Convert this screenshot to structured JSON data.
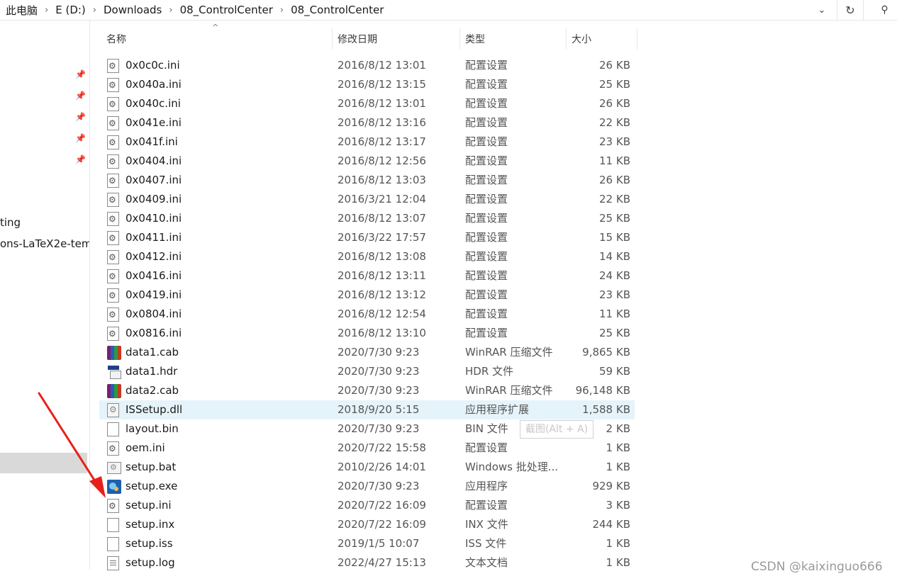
{
  "breadcrumb": [
    "此电脑",
    "E (D:)",
    "Downloads",
    "08_ControlCenter",
    "08_ControlCenter"
  ],
  "nav": {
    "items": [
      "ting",
      "ons-LaTeX2e-tem"
    ]
  },
  "columns": {
    "name": "名称",
    "date": "修改日期",
    "type": "类型",
    "size": "大小"
  },
  "files": [
    {
      "name": "0x0c0c.ini",
      "date": "2016/8/12 13:01",
      "type": "配置设置",
      "size": "26 KB",
      "icon": "gear"
    },
    {
      "name": "0x040a.ini",
      "date": "2016/8/12 13:15",
      "type": "配置设置",
      "size": "25 KB",
      "icon": "gear"
    },
    {
      "name": "0x040c.ini",
      "date": "2016/8/12 13:01",
      "type": "配置设置",
      "size": "26 KB",
      "icon": "gear"
    },
    {
      "name": "0x041e.ini",
      "date": "2016/8/12 13:16",
      "type": "配置设置",
      "size": "22 KB",
      "icon": "gear"
    },
    {
      "name": "0x041f.ini",
      "date": "2016/8/12 13:17",
      "type": "配置设置",
      "size": "23 KB",
      "icon": "gear"
    },
    {
      "name": "0x0404.ini",
      "date": "2016/8/12 12:56",
      "type": "配置设置",
      "size": "11 KB",
      "icon": "gear"
    },
    {
      "name": "0x0407.ini",
      "date": "2016/8/12 13:03",
      "type": "配置设置",
      "size": "26 KB",
      "icon": "gear"
    },
    {
      "name": "0x0409.ini",
      "date": "2016/3/21 12:04",
      "type": "配置设置",
      "size": "22 KB",
      "icon": "gear"
    },
    {
      "name": "0x0410.ini",
      "date": "2016/8/12 13:07",
      "type": "配置设置",
      "size": "25 KB",
      "icon": "gear"
    },
    {
      "name": "0x0411.ini",
      "date": "2016/3/22 17:57",
      "type": "配置设置",
      "size": "15 KB",
      "icon": "gear"
    },
    {
      "name": "0x0412.ini",
      "date": "2016/8/12 13:08",
      "type": "配置设置",
      "size": "14 KB",
      "icon": "gear"
    },
    {
      "name": "0x0416.ini",
      "date": "2016/8/12 13:11",
      "type": "配置设置",
      "size": "24 KB",
      "icon": "gear"
    },
    {
      "name": "0x0419.ini",
      "date": "2016/8/12 13:12",
      "type": "配置设置",
      "size": "23 KB",
      "icon": "gear"
    },
    {
      "name": "0x0804.ini",
      "date": "2016/8/12 12:54",
      "type": "配置设置",
      "size": "11 KB",
      "icon": "gear"
    },
    {
      "name": "0x0816.ini",
      "date": "2016/8/12 13:10",
      "type": "配置设置",
      "size": "25 KB",
      "icon": "gear"
    },
    {
      "name": "data1.cab",
      "date": "2020/7/30 9:23",
      "type": "WinRAR 压缩文件",
      "size": "9,865 KB",
      "icon": "rar"
    },
    {
      "name": "data1.hdr",
      "date": "2020/7/30 9:23",
      "type": "HDR 文件",
      "size": "59 KB",
      "icon": "hdr"
    },
    {
      "name": "data2.cab",
      "date": "2020/7/30 9:23",
      "type": "WinRAR 压缩文件",
      "size": "96,148 KB",
      "icon": "rar"
    },
    {
      "name": "ISSetup.dll",
      "date": "2018/9/20 5:15",
      "type": "应用程序扩展",
      "size": "1,588 KB",
      "icon": "dll",
      "highlight": true
    },
    {
      "name": "layout.bin",
      "date": "2020/7/30 9:23",
      "type": "BIN 文件",
      "size": "2 KB",
      "icon": "blank"
    },
    {
      "name": "oem.ini",
      "date": "2020/7/22 15:58",
      "type": "配置设置",
      "size": "1 KB",
      "icon": "gear"
    },
    {
      "name": "setup.bat",
      "date": "2010/2/26 14:01",
      "type": "Windows 批处理...",
      "size": "1 KB",
      "icon": "bat"
    },
    {
      "name": "setup.exe",
      "date": "2020/7/30 9:23",
      "type": "应用程序",
      "size": "929 KB",
      "icon": "exe"
    },
    {
      "name": "setup.ini",
      "date": "2020/7/22 16:09",
      "type": "配置设置",
      "size": "3 KB",
      "icon": "gear"
    },
    {
      "name": "setup.inx",
      "date": "2020/7/22 16:09",
      "type": "INX 文件",
      "size": "244 KB",
      "icon": "blank"
    },
    {
      "name": "setup.iss",
      "date": "2019/1/5 10:07",
      "type": "ISS 文件",
      "size": "1 KB",
      "icon": "blank"
    },
    {
      "name": "setup.log",
      "date": "2022/4/27 15:13",
      "type": "文本文档",
      "size": "1 KB",
      "icon": "text"
    }
  ],
  "tooltip": "截图(Alt + A)",
  "watermark": "CSDN @kaixinguo666",
  "colors": {
    "arrow": "#e8201a",
    "selection": "#e5f3fb",
    "nav_selected": "#d9d9d9"
  }
}
